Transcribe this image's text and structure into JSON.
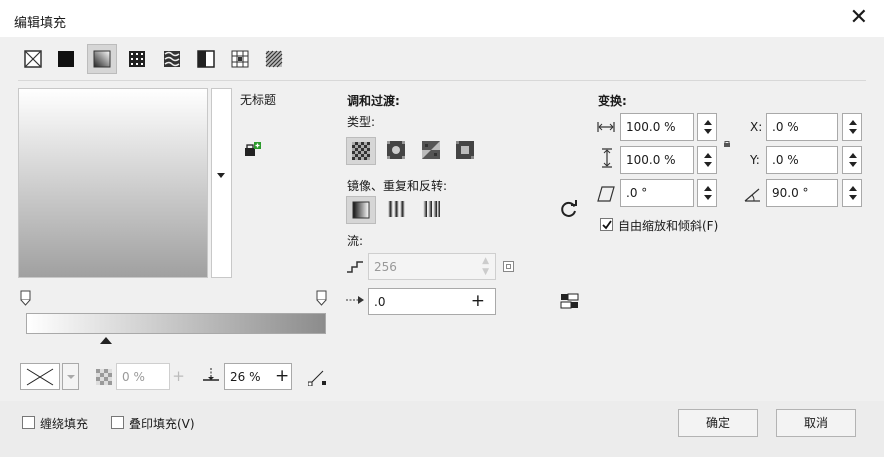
{
  "window": {
    "title": "编辑填充",
    "close_glyph": "✕"
  },
  "preview": {
    "name": "无标题"
  },
  "gradient_bar": {
    "start_color": "#ffffff",
    "end_color": "#8c8c8c"
  },
  "blend_section": {
    "heading": "调和过渡:",
    "type_label": "类型:",
    "mirror_label": "镜像、重复和反转:",
    "flow_label": "流:",
    "steps_value": "256",
    "accel_value": ".0"
  },
  "transform_section": {
    "heading": "变换:",
    "width_value": "100.0 %",
    "height_value": "100.0 %",
    "skew_value": ".0 °",
    "x_label": "X:",
    "x_value": ".0 %",
    "y_label": "Y:",
    "y_value": ".0 %",
    "rotate_value": "90.0 °",
    "free_scale_label": "自由缩放和倾斜(F)",
    "free_scale_checked": true
  },
  "bottom_tools": {
    "transparency_value": "0 %",
    "midpoint_value": "26 %"
  },
  "footer": {
    "wrap_fill_label": "缠绕填充",
    "overprint_label": "叠印填充(V)",
    "ok_label": "确定",
    "cancel_label": "取消"
  }
}
